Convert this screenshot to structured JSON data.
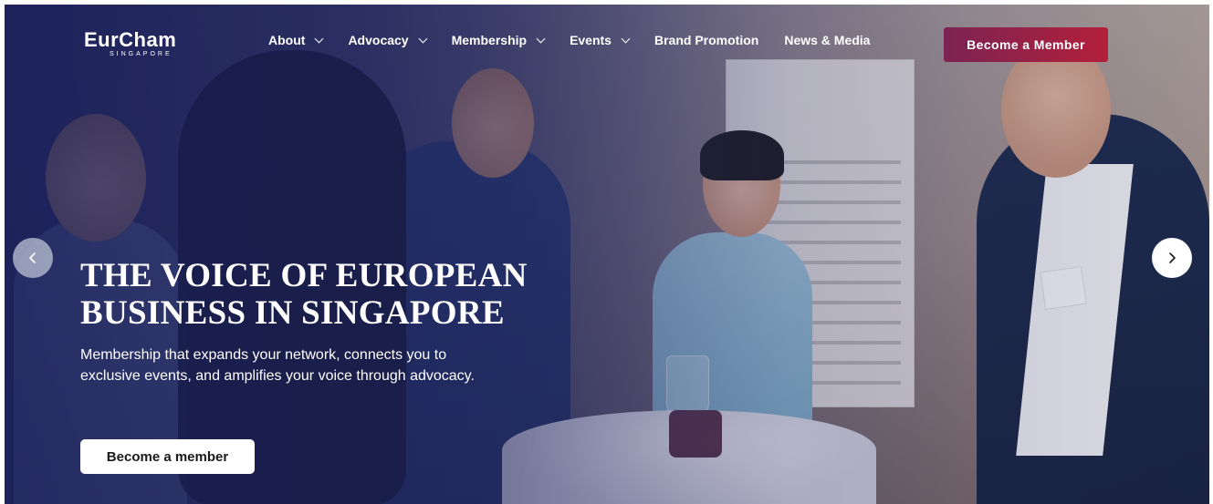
{
  "brand": {
    "logo_text": "EurCham",
    "logo_subtext": "SINGAPORE"
  },
  "nav": {
    "items": [
      {
        "label": "About",
        "dropdown": true
      },
      {
        "label": "Advocacy",
        "dropdown": true
      },
      {
        "label": "Membership",
        "dropdown": true
      },
      {
        "label": "Events",
        "dropdown": true
      },
      {
        "label": "Brand Promotion",
        "dropdown": false
      },
      {
        "label": "News & Media",
        "dropdown": false
      }
    ],
    "cta_label": "Become a Member"
  },
  "hero": {
    "headline_line1": "THE VOICE OF EUROPEAN",
    "headline_line2": "BUSINESS IN SINGAPORE",
    "subtext": "Membership that expands your network, connects you to exclusive events, and amplifies your voice through advocacy.",
    "cta_label": "Become a member"
  },
  "carousel": {
    "prev_icon": "chevron-left-icon",
    "next_icon": "chevron-right-icon"
  },
  "colors": {
    "overlay": "#1c225c",
    "cta_gradient_start": "#7b2353",
    "cta_gradient_end": "#b3203a",
    "text": "#ffffff"
  }
}
